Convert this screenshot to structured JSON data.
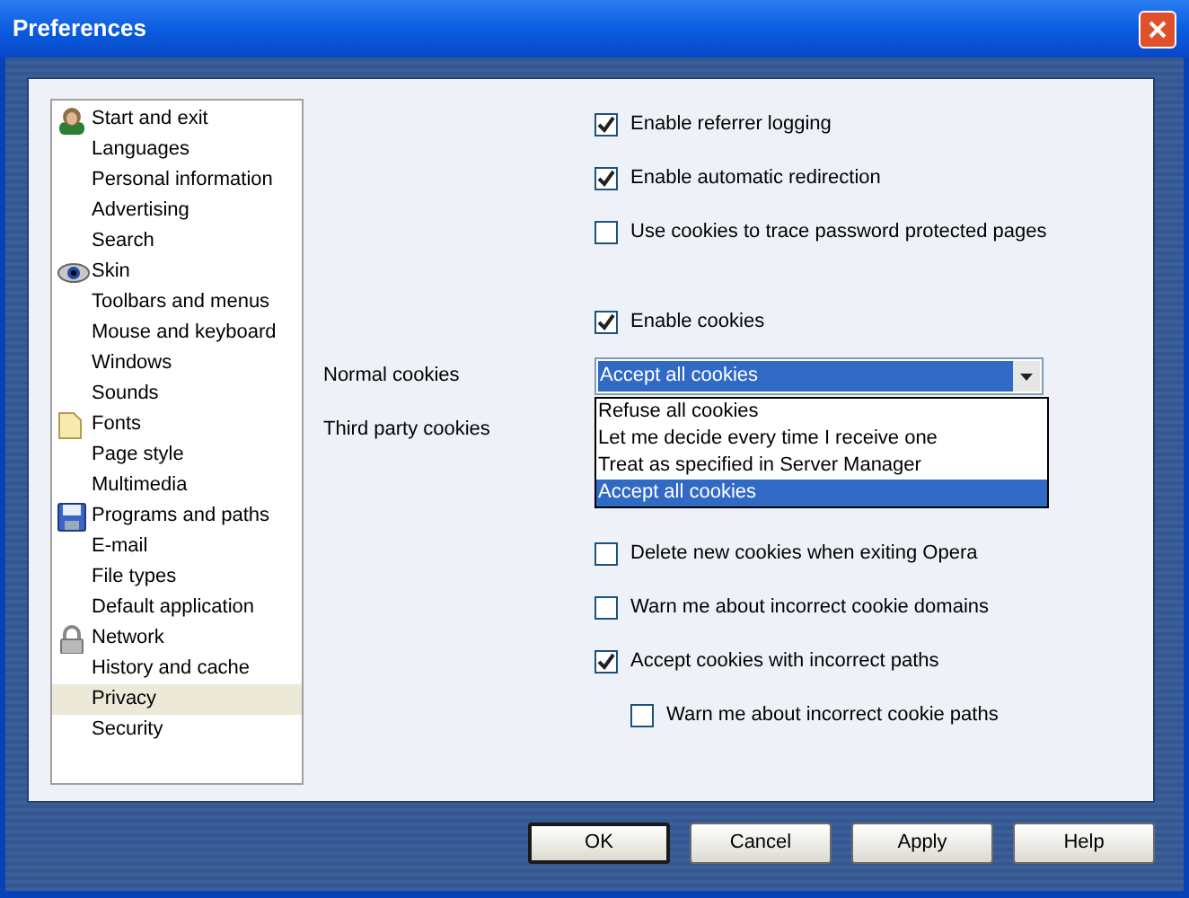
{
  "window": {
    "title": "Preferences"
  },
  "sidebar": {
    "items": [
      {
        "label": "Start and exit",
        "kind": "person",
        "selected": false
      },
      {
        "label": "Languages",
        "selected": false
      },
      {
        "label": "Personal information",
        "selected": false
      },
      {
        "label": "Advertising",
        "selected": false
      },
      {
        "label": "Search",
        "selected": false
      },
      {
        "label": "Skin",
        "kind": "eye",
        "selected": false
      },
      {
        "label": "Toolbars and menus",
        "selected": false
      },
      {
        "label": "Mouse and keyboard",
        "selected": false
      },
      {
        "label": "Windows",
        "selected": false
      },
      {
        "label": "Sounds",
        "selected": false
      },
      {
        "label": "Fonts",
        "kind": "page",
        "selected": false
      },
      {
        "label": "Page style",
        "selected": false
      },
      {
        "label": "Multimedia",
        "selected": false
      },
      {
        "label": "Programs and paths",
        "kind": "disk",
        "selected": false
      },
      {
        "label": "E-mail",
        "selected": false
      },
      {
        "label": "File types",
        "selected": false
      },
      {
        "label": "Default application",
        "selected": false
      },
      {
        "label": "Network",
        "kind": "lock",
        "selected": false
      },
      {
        "label": "History and cache",
        "selected": false
      },
      {
        "label": "Privacy",
        "selected": true
      },
      {
        "label": "Security",
        "selected": false
      }
    ]
  },
  "options_top": [
    {
      "label": "Enable referrer logging",
      "checked": true
    },
    {
      "label": "Enable automatic redirection",
      "checked": true
    },
    {
      "label": "Use cookies to trace password protected pages",
      "checked": false
    }
  ],
  "enable_cookies": {
    "label": "Enable cookies",
    "checked": true
  },
  "normal_cookies": {
    "label": "Normal cookies",
    "value": "Accept all cookies",
    "expanded": true,
    "options": [
      {
        "label": "Refuse all cookies",
        "selected": false
      },
      {
        "label": "Let me decide every time I receive one",
        "selected": false
      },
      {
        "label": "Treat as specified in Server Manager",
        "selected": false
      },
      {
        "label": "Accept all cookies",
        "selected": true
      }
    ]
  },
  "third_party_cookies": {
    "label": "Third party cookies"
  },
  "options_bottom": [
    {
      "label": "Delete new cookies when exiting Opera",
      "checked": false
    },
    {
      "label": "Warn me about incorrect cookie domains",
      "checked": false
    },
    {
      "label": "Accept cookies with incorrect paths",
      "checked": true,
      "children": [
        {
          "label": "Warn me about incorrect cookie paths",
          "checked": false
        }
      ]
    }
  ],
  "buttons": [
    {
      "label": "OK",
      "default": true
    },
    {
      "label": "Cancel",
      "default": false
    },
    {
      "label": "Apply",
      "default": false
    },
    {
      "label": "Help",
      "default": false
    }
  ]
}
